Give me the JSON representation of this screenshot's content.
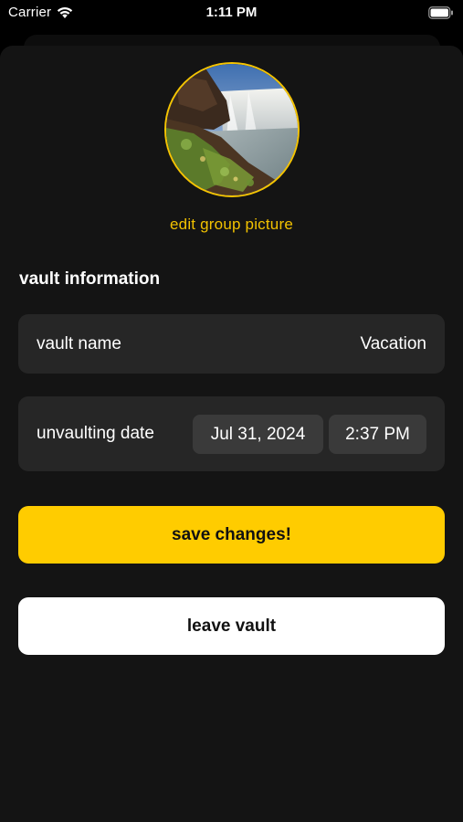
{
  "status_bar": {
    "carrier": "Carrier",
    "time": "1:11 PM",
    "wifi_icon": "wifi-icon",
    "battery_icon": "battery-icon"
  },
  "profile": {
    "avatar_icon": "group-picture-waterfall",
    "edit_label": "edit group picture"
  },
  "vault_info": {
    "section_title": "vault information",
    "name_label": "vault name",
    "name_value": "Vacation",
    "date_label": "unvaulting date",
    "date_value": "Jul 31, 2024",
    "time_value": "2:37 PM"
  },
  "actions": {
    "save_label": "save changes!",
    "leave_label": "leave vault"
  },
  "colors": {
    "accent": "#ffcc00",
    "background": "#141414",
    "card": "#262626",
    "pill": "#3a3a3a"
  }
}
